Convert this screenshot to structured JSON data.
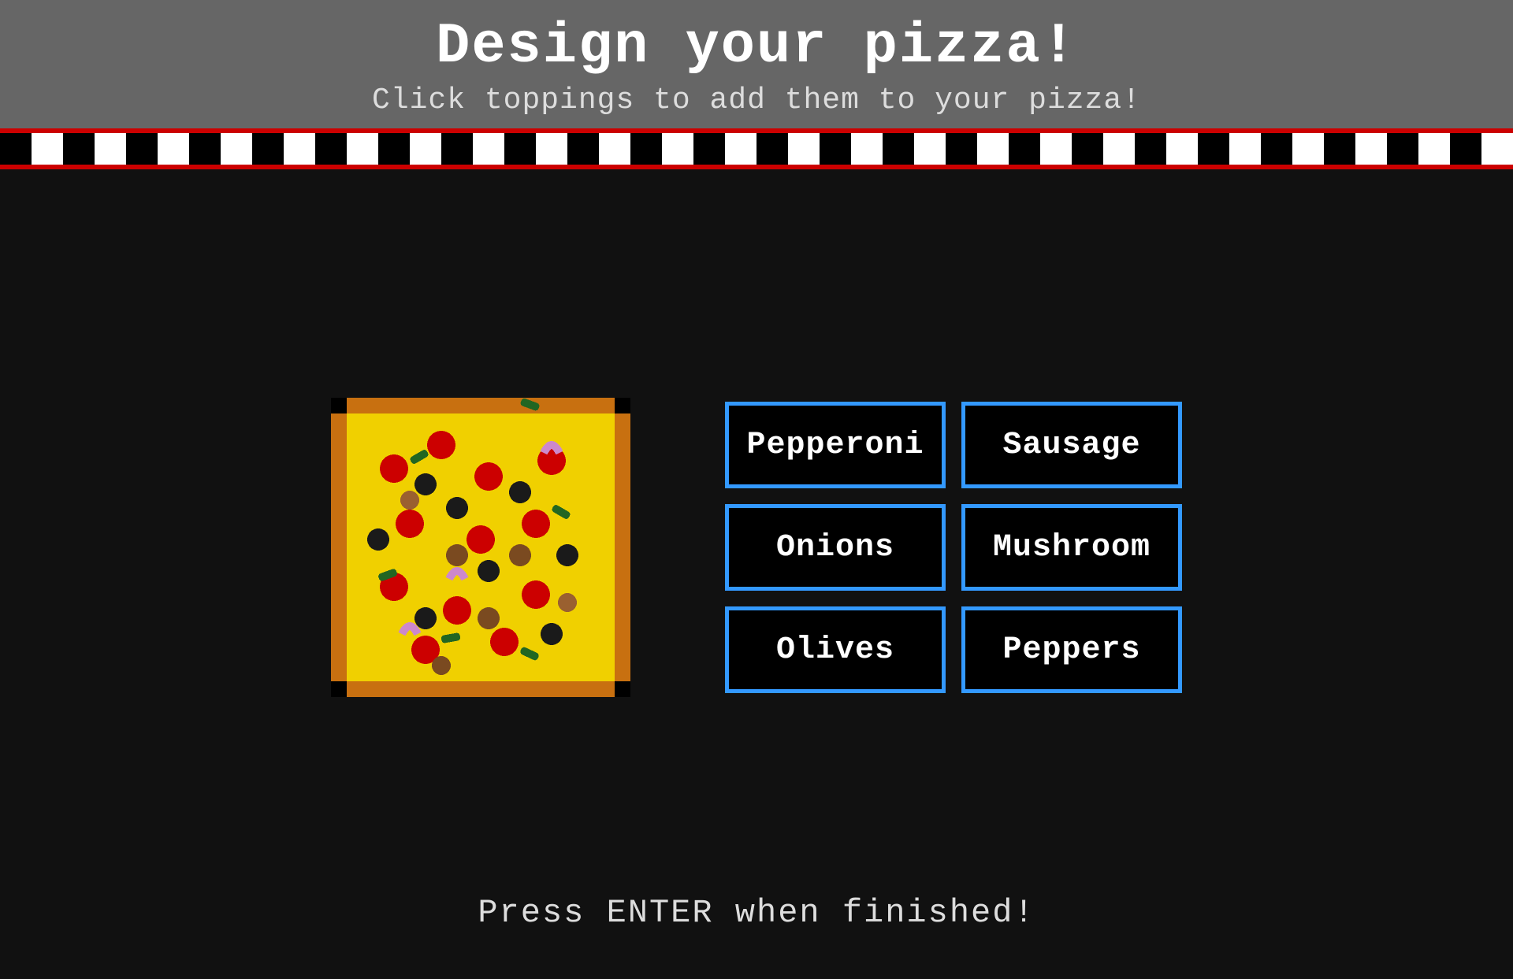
{
  "header": {
    "title": "Design your pizza!",
    "subtitle": "Click toppings to add them to your pizza!"
  },
  "toppings": [
    {
      "id": "pepperoni",
      "label": "Pepperoni"
    },
    {
      "id": "sausage",
      "label": "Sausage"
    },
    {
      "id": "onions",
      "label": "Onions"
    },
    {
      "id": "mushroom",
      "label": "Mushroom"
    },
    {
      "id": "olives",
      "label": "Olives"
    },
    {
      "id": "peppers",
      "label": "Peppers"
    }
  ],
  "bottom_prompt": "Press ENTER when finished!",
  "colors": {
    "header_bg": "#666666",
    "checker_red": "#cc0000",
    "main_bg": "#111111",
    "button_border": "#3399ff",
    "button_text": "#ffffff"
  }
}
